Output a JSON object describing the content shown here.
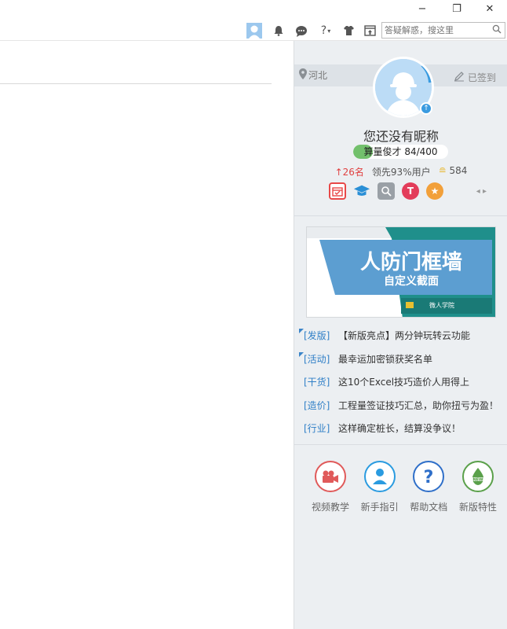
{
  "window": {
    "minimize": "−",
    "restore": "❐",
    "close": "✕"
  },
  "toolbar": {
    "help_label": "?",
    "search_placeholder": "答疑解惑，搜这里"
  },
  "panel": {
    "location": "河北",
    "signed_label": "已签到",
    "nickname": "您还没有昵称",
    "level": {
      "title": "算量俊才",
      "progress_text": "84/400",
      "progress": 0.21
    },
    "stats": {
      "rank": "↑26名",
      "lead": "领先93%用户",
      "coins": "584"
    },
    "banner": {
      "title": "人防门框墙",
      "subtitle": "自定义截面",
      "brand": "微人学院"
    },
    "news": [
      {
        "tag": "[发版]",
        "text": "【新版亮点】两分钟玩转云功能",
        "corner": true
      },
      {
        "tag": "[活动]",
        "text": "最幸运加密锁获奖名单",
        "corner": true
      },
      {
        "tag": "[干货]",
        "text": "这10个Excel技巧造价人用得上",
        "corner": false
      },
      {
        "tag": "[造价]",
        "text": "工程量签证技巧汇总，助你扭亏为盈！",
        "corner": false
      },
      {
        "tag": "[行业]",
        "text": "这样确定桩长，结算没争议！",
        "corner": false
      }
    ],
    "tools": [
      {
        "label": "视频教学",
        "icon": "video-camera-icon",
        "color": "#e05a5a"
      },
      {
        "label": "新手指引",
        "icon": "user-guide-icon",
        "color": "#2a9be0"
      },
      {
        "label": "帮助文档",
        "icon": "help-doc-icon",
        "color": "#2f6fc9"
      },
      {
        "label": "新版特性",
        "icon": "new-feature-icon",
        "color": "#5aa04a"
      }
    ]
  }
}
